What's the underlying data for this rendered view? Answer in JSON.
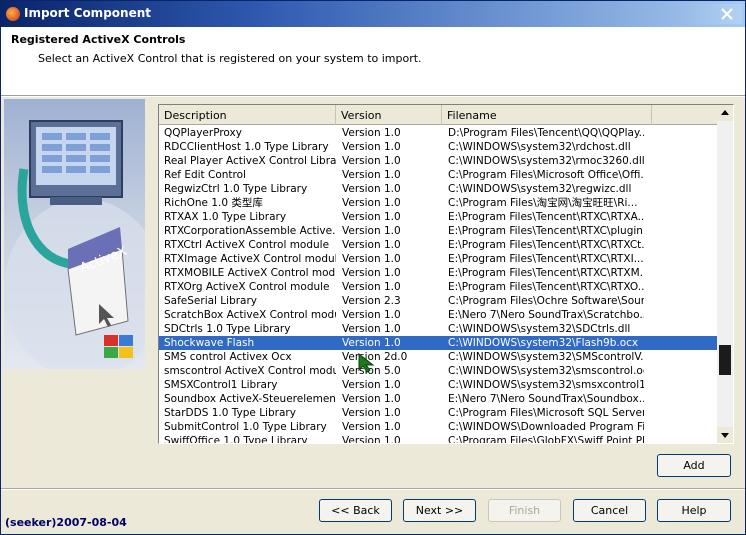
{
  "window": {
    "title": "Import Component",
    "icon": "java-cup-icon",
    "close_icon": "close-x-icon"
  },
  "header": {
    "title": "Registered ActiveX Controls",
    "subtitle": "Select an ActiveX Control that is registered on your system to import."
  },
  "graphic": {
    "label": "ActiveX"
  },
  "table": {
    "columns": [
      "Description",
      "Version",
      "Filename"
    ],
    "selected_index": 15,
    "rows": [
      {
        "description": "QQPlayerProxy",
        "version": "Version 1.0",
        "filename": "D:\\Program Files\\Tencent\\QQ\\QQPlay..."
      },
      {
        "description": "RDCClientHost 1.0 Type Library",
        "version": "Version 1.0",
        "filename": "C:\\WINDOWS\\system32\\rdchost.dll"
      },
      {
        "description": "Real Player ActiveX Control Library",
        "version": "Version 1.0",
        "filename": "C:\\WINDOWS\\system32\\rmoc3260.dll"
      },
      {
        "description": "Ref Edit Control",
        "version": "Version 1.0",
        "filename": "C:\\Program Files\\Microsoft Office\\Offi..."
      },
      {
        "description": "RegwizCtrl 1.0 Type Library",
        "version": "Version 1.0",
        "filename": "C:\\WINDOWS\\system32\\regwizc.dll"
      },
      {
        "description": "RichOne 1.0 类型库",
        "version": "Version 1.0",
        "filename": "C:\\Program Files\\淘宝网\\淘宝旺旺\\Ri..."
      },
      {
        "description": "RTXAX 1.0 Type Library",
        "version": "Version 1.0",
        "filename": "E:\\Program Files\\Tencent\\RTXC\\RTXA..."
      },
      {
        "description": "RTXCorporationAssemble Active...",
        "version": "Version 1.0",
        "filename": "E:\\Program Files\\Tencent\\RTXC\\plugin..."
      },
      {
        "description": "RTXCtrl ActiveX Control module",
        "version": "Version 1.0",
        "filename": "E:\\Program Files\\Tencent\\RTXC\\RTXCt..."
      },
      {
        "description": "RTXImage ActiveX Control module",
        "version": "Version 1.0",
        "filename": "E:\\Program Files\\Tencent\\RTXC\\RTXI..."
      },
      {
        "description": "RTXMOBILE ActiveX Control module",
        "version": "Version 1.0",
        "filename": "E:\\Program Files\\Tencent\\RTXC\\RTXM..."
      },
      {
        "description": "RTXOrg ActiveX Control module",
        "version": "Version 1.0",
        "filename": "E:\\Program Files\\Tencent\\RTXC\\RTXO..."
      },
      {
        "description": "SafeSerial Library",
        "version": "Version 2.3",
        "filename": "C:\\Program Files\\Ochre Software\\Sour..."
      },
      {
        "description": "ScratchBox ActiveX Control module",
        "version": "Version 1.0",
        "filename": "E:\\Nero 7\\Nero SoundTrax\\Scratchbo..."
      },
      {
        "description": "SDCtrls 1.0 Type Library",
        "version": "Version 1.0",
        "filename": "C:\\WINDOWS\\system32\\SDCtrls.dll"
      },
      {
        "description": "Shockwave Flash",
        "version": "Version 1.0",
        "filename": "C:\\WINDOWS\\system32\\Flash9b.ocx"
      },
      {
        "description": "SMS control Activex Ocx",
        "version": "Version 2d.0",
        "filename": "C:\\WINDOWS\\system32\\SMScontrolV..."
      },
      {
        "description": "smscontrol ActiveX Control module",
        "version": "Version 5.0",
        "filename": "C:\\WINDOWS\\system32\\smscontrol.ocx"
      },
      {
        "description": "SMSXControl1 Library",
        "version": "Version 1.0",
        "filename": "C:\\WINDOWS\\system32\\smsxcontrol1..."
      },
      {
        "description": "Soundbox ActiveX-Steuerelemen...",
        "version": "Version 1.0",
        "filename": "E:\\Nero 7\\Nero SoundTrax\\Soundbox..."
      },
      {
        "description": "StarDDS 1.0 Type Library",
        "version": "Version 1.0",
        "filename": "C:\\Program Files\\Microsoft SQL Server..."
      },
      {
        "description": "SubmitControl 1.0 Type Library",
        "version": "Version 1.0",
        "filename": "C:\\WINDOWS\\Downloaded Program Fi..."
      },
      {
        "description": "SwiffOffice 1.0 Type Library",
        "version": "Version 1.0",
        "filename": "C:\\Program Files\\GlobFX\\Swiff Point Pl..."
      }
    ]
  },
  "buttons": {
    "add": "Add",
    "back": "<< Back",
    "next": "Next >>",
    "finish": "Finish",
    "cancel": "Cancel",
    "help": "Help"
  },
  "watermark": "(seeker)2007-08-04",
  "colors": {
    "title_gradient_start": "#0a246a",
    "title_gradient_end": "#a6caf0",
    "selection": "#316ac5",
    "dialog_bg": "#ece9d8"
  }
}
